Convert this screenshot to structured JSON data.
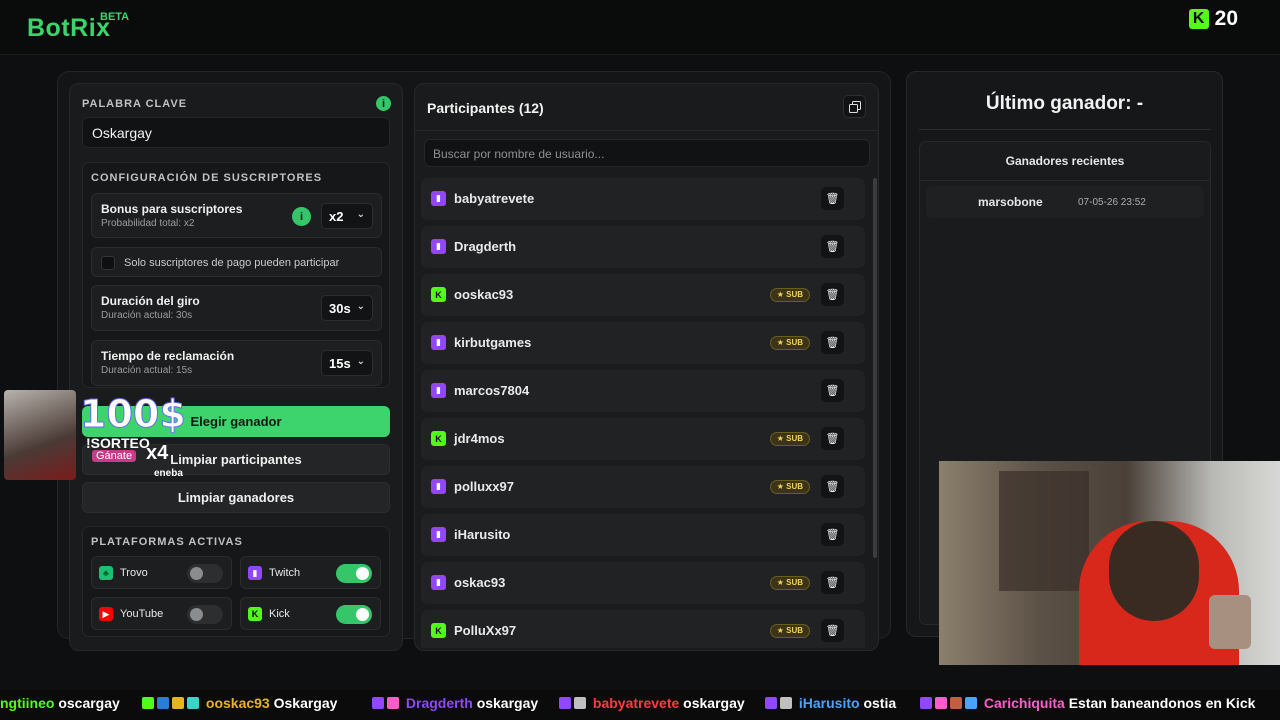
{
  "header": {
    "logo": "BotRix",
    "beta": "BETA",
    "kick_letter": "K",
    "credits": "20"
  },
  "keyword": {
    "label": "PALABRA CLAVE",
    "info_icon": "i",
    "value": "Oskargay"
  },
  "subs_config": {
    "title": "CONFIGURACIÓN DE SUSCRIPTORES",
    "bonus_title": "Bonus para suscriptores",
    "bonus_sub": "Probabilidad total: x2",
    "bonus_value": "x2",
    "paid_only_label": "Solo suscriptores de pago pueden participar",
    "spin_title": "Duración del giro",
    "spin_sub": "Duración actual: 30s",
    "spin_value": "30s",
    "claim_title": "Tiempo de reclamación",
    "claim_sub": "Duración actual: 15s",
    "claim_value": "15s"
  },
  "actions": {
    "pick_winner": "Elegir ganador",
    "clear_participants": "Limpiar participantes",
    "clear_winners": "Limpiar ganadores"
  },
  "platforms": {
    "title": "PLATAFORMAS ACTIVAS",
    "items": [
      {
        "name": "Trovo",
        "icon": "trovo-icon",
        "color": "#1dbf73",
        "enabled": false
      },
      {
        "name": "Twitch",
        "icon": "twitch-icon",
        "color": "#9146ff",
        "enabled": true
      },
      {
        "name": "YouTube",
        "icon": "youtube-icon",
        "color": "#ff0000",
        "enabled": false
      },
      {
        "name": "Kick",
        "icon": "kick-icon",
        "color": "#53fc18",
        "enabled": true
      }
    ]
  },
  "participants": {
    "title": "Participantes (12)",
    "search_placeholder": "Buscar por nombre de usuario...",
    "sub_label": "SUB",
    "list": [
      {
        "name": "babyatrevete",
        "platform": "twitch",
        "sub": false
      },
      {
        "name": "Dragderth",
        "platform": "twitch",
        "sub": false
      },
      {
        "name": "ooskac93",
        "platform": "kick",
        "sub": true
      },
      {
        "name": "kirbutgames",
        "platform": "twitch",
        "sub": true
      },
      {
        "name": "marcos7804",
        "platform": "twitch",
        "sub": false
      },
      {
        "name": "jdr4mos",
        "platform": "kick",
        "sub": true
      },
      {
        "name": "polluxx97",
        "platform": "twitch",
        "sub": true
      },
      {
        "name": "iHarusito",
        "platform": "twitch",
        "sub": false
      },
      {
        "name": "oskac93",
        "platform": "twitch",
        "sub": true
      },
      {
        "name": "PolluXx97",
        "platform": "kick",
        "sub": true
      }
    ]
  },
  "winner": {
    "title": "Último ganador: -",
    "recent_title": "Ganadores recientes",
    "recent": [
      {
        "name": "marsobone",
        "date": "07-05-26 23:52"
      }
    ]
  },
  "promo": {
    "amount": "100$",
    "line1": "!SORTEO",
    "line2": "Gánate",
    "mult": "x4",
    "brand": "eneba"
  },
  "chat": [
    {
      "user": "ngtiineo",
      "text": "oscargay",
      "color": "#53fc18"
    },
    {
      "user": "ooskac93",
      "text": "Oskargay",
      "color": "#e6b422"
    },
    {
      "user": "Dragderth",
      "text": "oskargay",
      "color": "#9146ff"
    },
    {
      "user": "babyatrevete",
      "text": "oskargay",
      "color": "#ff3d3d"
    },
    {
      "user": "iHarusito",
      "text": "ostia",
      "color": "#4aa3ff"
    },
    {
      "user": "Carichiquita",
      "text": "Estan baneandonos en Kick",
      "color": "#ff5ec8"
    }
  ]
}
